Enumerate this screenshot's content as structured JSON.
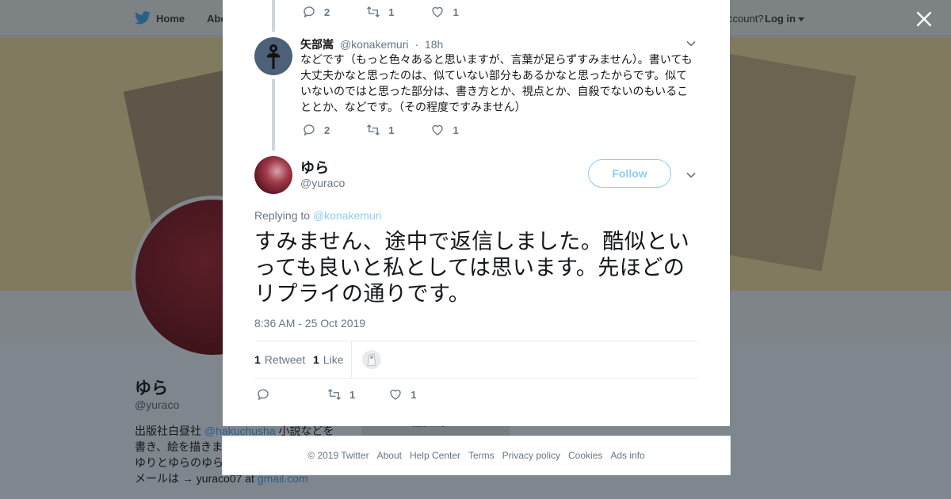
{
  "colors": {
    "overlay_bg": "#7f868d",
    "modal_bg": "#ffffff",
    "accent_light_blue": "#8ecdf5",
    "muted_text": "#657786",
    "thread_line": "#ccd6dd"
  },
  "background_page": {
    "nav": {
      "home_label": "Home",
      "about_label": "Abo",
      "account_prompt": "ccount?",
      "login_label": "Log in"
    },
    "profile": {
      "name": "ゆら",
      "handle": "@yuraco",
      "bio_prefix": "出版社白昼社 ",
      "bio_link": "@hakuchusha",
      "bio_line1_suffix": " 小説などを",
      "bio_line2": "書き、絵を描きま",
      "bio_line3": "ゆりとゆらのゆら",
      "bio_line4_prefix": "メールは → yuraco07 at ",
      "bio_line4_link": "gmail.com",
      "card_text": "ads info"
    }
  },
  "modal": {
    "prev_tweet_actions": {
      "replies": "2",
      "retweets": "1",
      "likes": "1"
    },
    "reply": {
      "author_name": "矢部嵩",
      "author_handle": "@konakemuri",
      "separator": "·",
      "time": "18h",
      "text": "などです（もっと色々あると思いますが、言葉が足らずすみません）。書いても大丈夫かなと思ったのは、似ていない部分もあるかなと思ったからです。似ていないのではと思った部分は、書き方とか、視点とか、自殺でないのもいることとか、などです。（その程度ですみません）",
      "actions": {
        "replies": "2",
        "retweets": "1",
        "likes": "1"
      }
    },
    "main_tweet": {
      "author_name": "ゆら",
      "author_handle": "@yuraco",
      "follow_label": "Follow",
      "replying_label": "Replying to",
      "replying_to": "@konakemuri",
      "text": "すみません、途中で返信しました。酷似といっても良いと私としては思います。先ほどのリプライの通りです。",
      "timestamp": "8:36 AM - 25 Oct 2019",
      "retweet_count": "1",
      "retweet_label": "Retweet",
      "like_count": "1",
      "like_label": "Like",
      "actions": {
        "replies": "",
        "retweets": "1",
        "likes": "1"
      }
    }
  },
  "footer": {
    "copyright": "© 2019 Twitter",
    "links": [
      "About",
      "Help Center",
      "Terms",
      "Privacy policy",
      "Cookies",
      "Ads info"
    ]
  }
}
